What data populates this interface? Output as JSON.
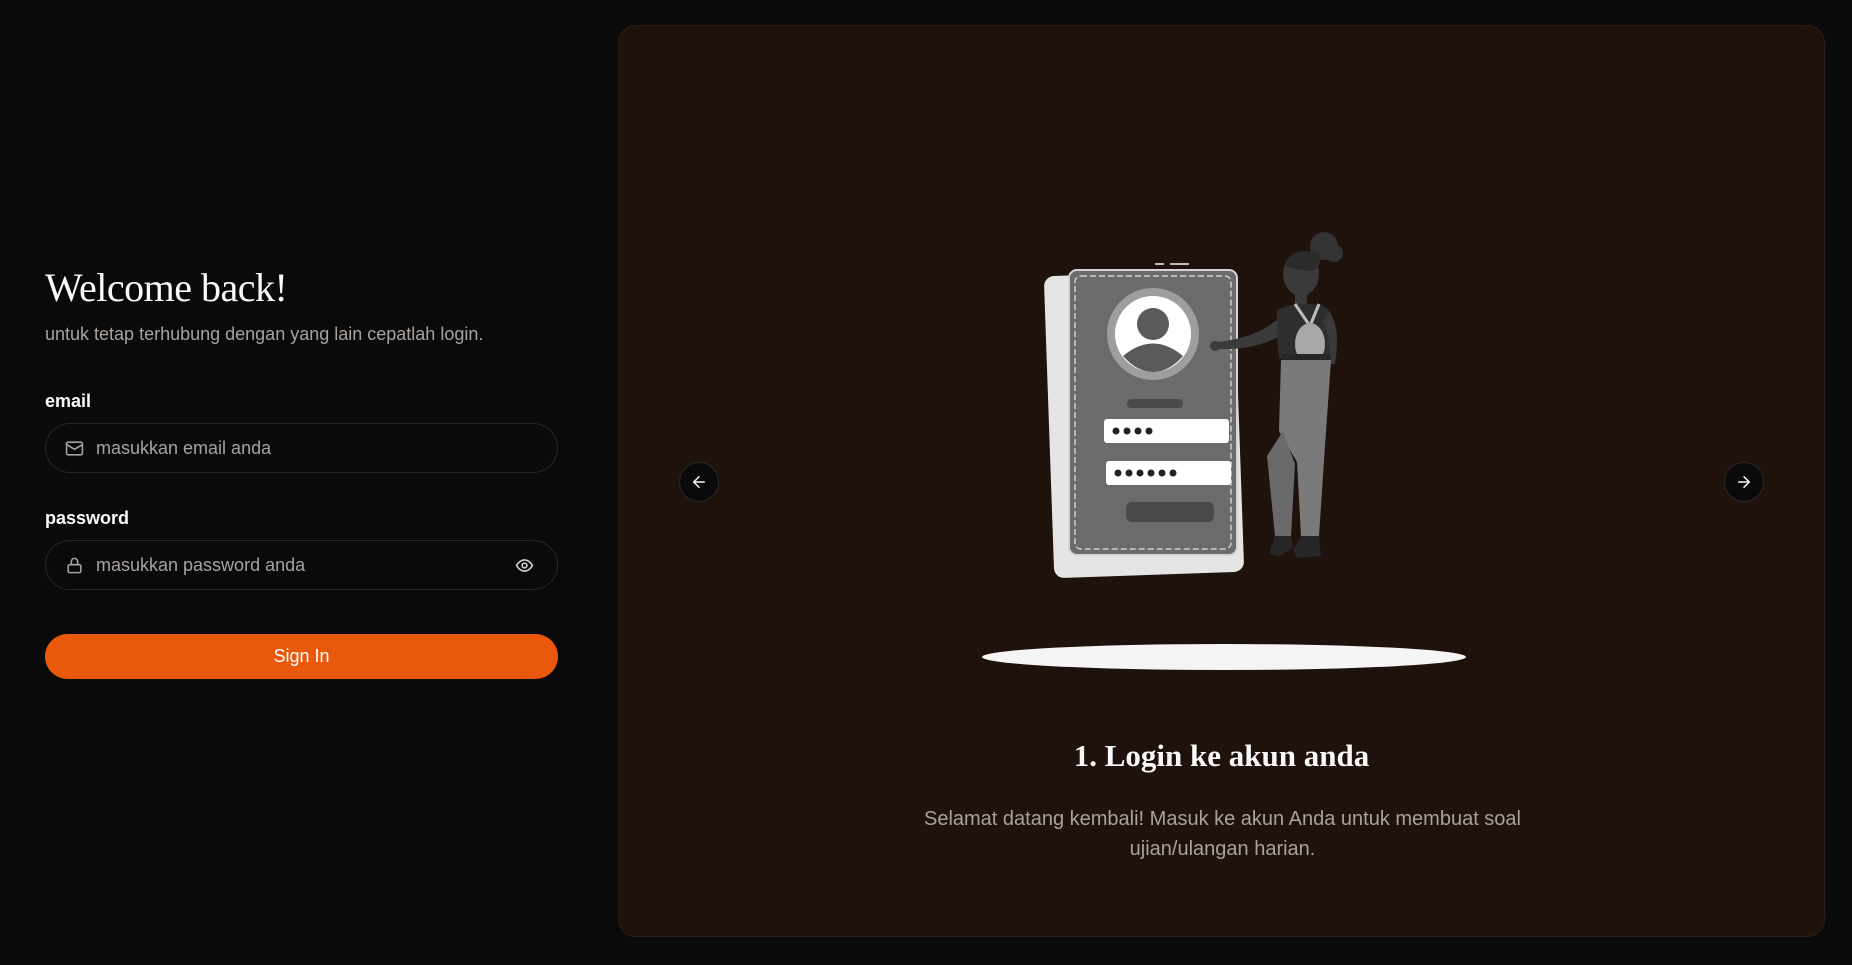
{
  "login": {
    "title": "Welcome back!",
    "subtitle": "untuk tetap terhubung dengan yang lain cepatlah login.",
    "email_label": "email",
    "email_placeholder": "masukkan email anda",
    "email_icon": "mail-icon",
    "password_label": "password",
    "password_placeholder": "masukkan password anda",
    "password_icon": "lock-icon",
    "toggle_icon": "eye-icon",
    "submit_label": "Sign In"
  },
  "carousel": {
    "prev_icon": "arrow-left-icon",
    "next_icon": "arrow-right-icon",
    "slide_title": "1. Login ke akun anda",
    "slide_description": "Selamat datang kembali! Masuk ke akun Anda untuk membuat soal ujian/ulangan harian."
  },
  "colors": {
    "background": "#0a0a0a",
    "panel": "#1f110c",
    "accent": "#ea580c",
    "muted_text": "#a8a29e"
  }
}
